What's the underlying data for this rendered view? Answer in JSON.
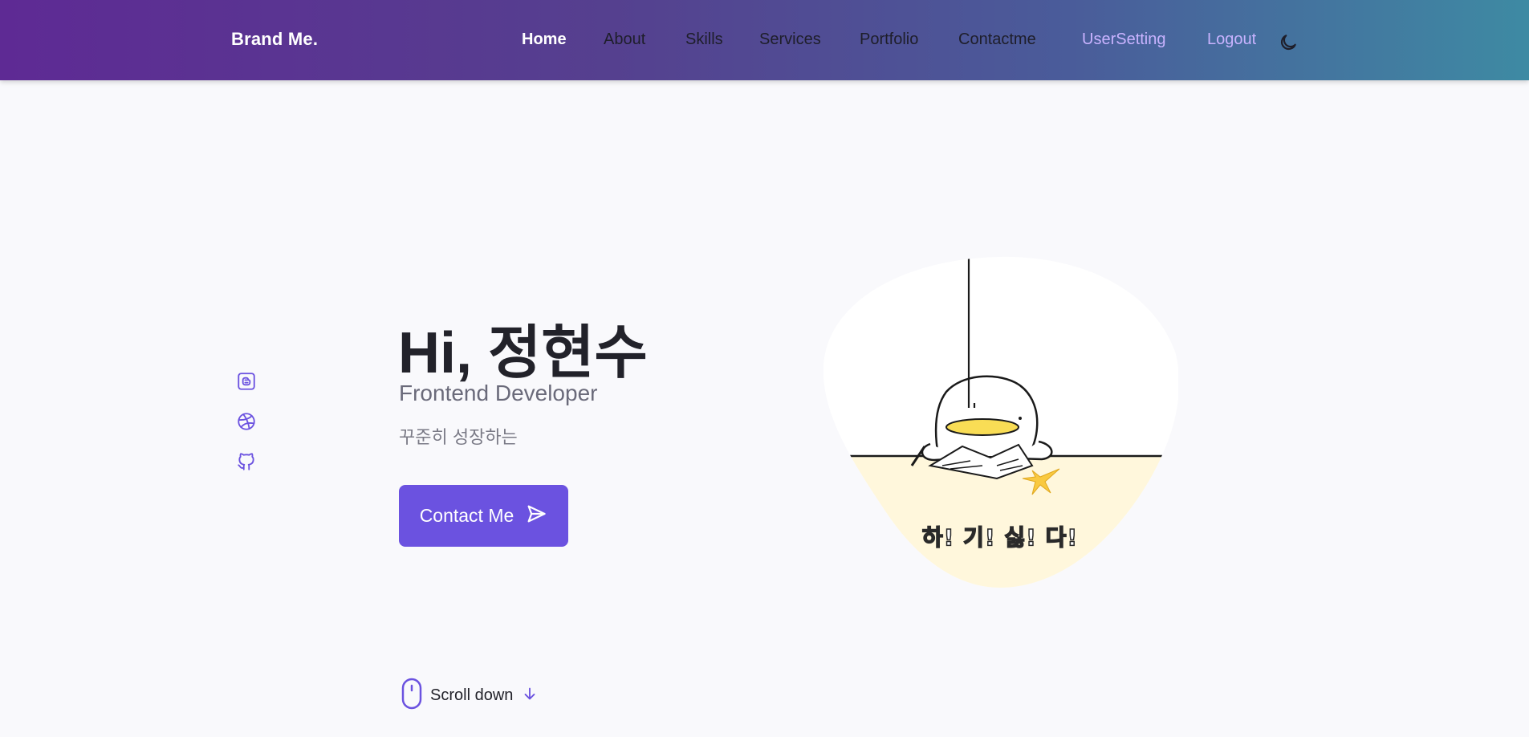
{
  "header": {
    "brand": "Brand Me.",
    "nav": [
      {
        "label": "Home",
        "state": "active"
      },
      {
        "label": "About",
        "state": "normal"
      },
      {
        "label": "Skills",
        "state": "normal"
      },
      {
        "label": "Services",
        "state": "normal"
      },
      {
        "label": "Portfolio",
        "state": "normal"
      },
      {
        "label": "Contactme",
        "state": "normal"
      },
      {
        "label": "UserSetting",
        "state": "accent"
      },
      {
        "label": "Logout",
        "state": "accent"
      }
    ],
    "theme_icon": "moon-icon"
  },
  "social": [
    {
      "icon": "blog-icon"
    },
    {
      "icon": "dribbble-icon"
    },
    {
      "icon": "github-icon"
    }
  ],
  "hero": {
    "title": "Hi, 정현수",
    "subtitle": "Frontend Developer",
    "description": "꾸준히 성장하는",
    "cta_label": "Contact Me",
    "cta_icon": "send-icon",
    "image_caption": "하! 기! 싫! 다!"
  },
  "scroll": {
    "label": "Scroll down",
    "mouse_icon": "mouse-icon",
    "arrow_icon": "arrow-down-icon"
  },
  "colors": {
    "accent": "#6b52e0",
    "header_gradient": [
      "#5e2a94",
      "#3e8aa3"
    ],
    "nav_accent": "#c9b3ff",
    "blob_fill": "#fff7dc"
  }
}
